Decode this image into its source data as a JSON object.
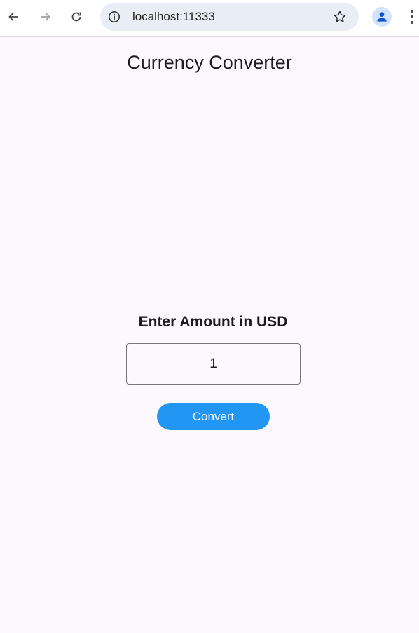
{
  "browser": {
    "url": "localhost:11333",
    "icons": {
      "back": "arrow-left-icon",
      "forward": "arrow-right-icon",
      "reload": "reload-icon",
      "info": "info-icon",
      "bookmark": "star-icon",
      "profile": "profile-icon",
      "menu": "kebab-menu-icon"
    }
  },
  "app": {
    "title": "Currency Converter",
    "amount_label": "Enter Amount in USD",
    "amount_value": "1",
    "convert_label": "Convert",
    "colors": {
      "background": "#fdf7fe",
      "button": "#2196f3",
      "button_text": "#ffffff",
      "text": "#1d1b20"
    }
  }
}
